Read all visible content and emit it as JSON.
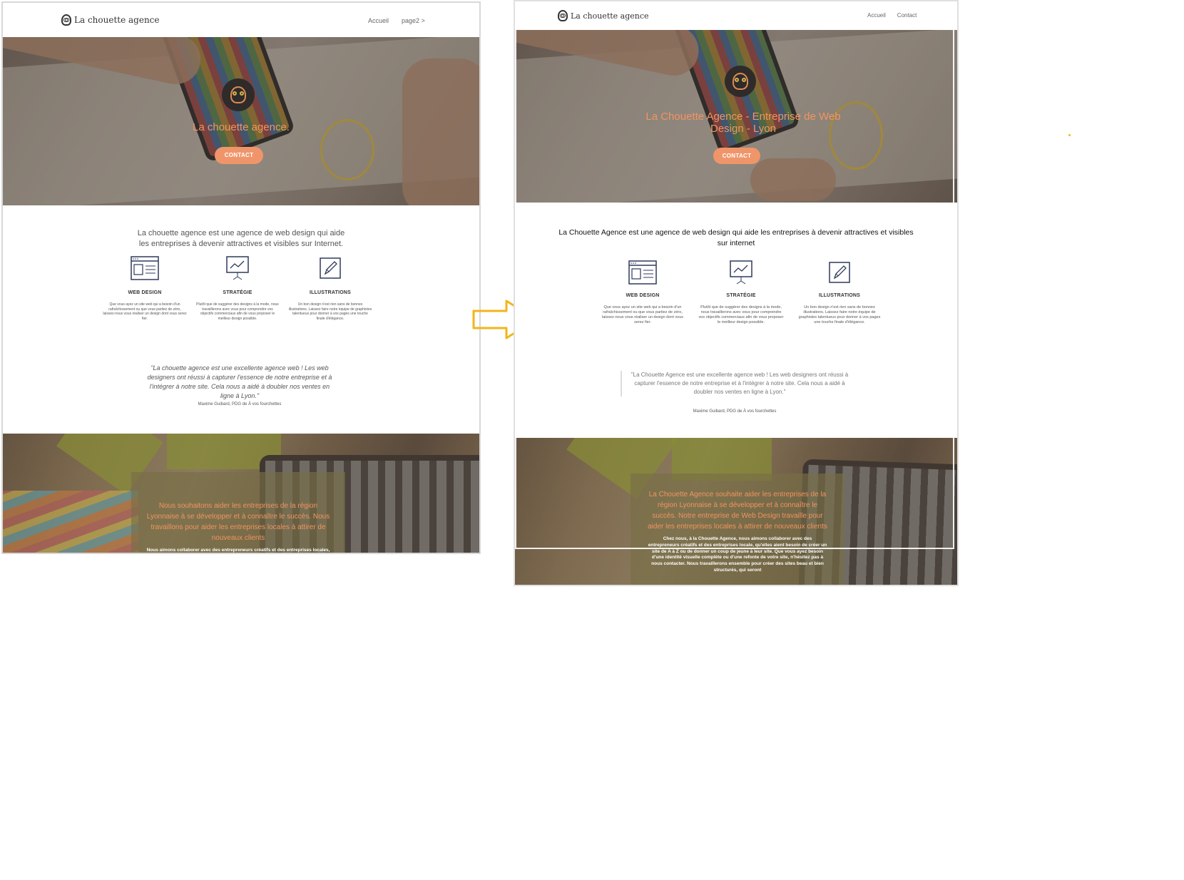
{
  "left": {
    "nav": {
      "logo_text": "La chouette agence",
      "links": [
        "Accueil",
        "page2 >"
      ]
    },
    "hero": {
      "title": "La chouette agence.",
      "cta": "CONTACT"
    },
    "intro": "La chouette agence est une agence de web design qui aide les entreprises à devenir attractives et visibles sur Internet.",
    "services": [
      {
        "title": "WEB DESIGN",
        "text": "Que vous ayez un site web qui a besoin d'un rafraîchissement ou que vous partiez de zéro, laissez-nous vous réaliser un design dont vous serez fier."
      },
      {
        "title": "STRATÉGIE",
        "text": "Plutôt que de suggérer des designs à la mode, nous travaillerons avec vous pour comprendre vos objectifs commerciaux afin de vous proposer le meilleur design possible."
      },
      {
        "title": "ILLUSTRATIONS",
        "text": "Un bon design n'est rien sans de bonnes illustrations. Laissez faire notre équipe de graphistes talentueux pour donner à vos pages une touche finale d'élégance."
      }
    ],
    "quote": "\"La chouette agence est une excellente agence web ! Les web designers ont réussi à capturer l'essence de notre entreprise et à l'intégrer à notre site. Cela nous a aidé à doubler nos ventes en ligne à Lyon.\"",
    "quote_author": "Maxime Guibard, PDG de À vos fourchettes",
    "bottom": {
      "title": "Nous souhaitons aider les entreprises de la région Lyonnaise à se développer et à connaître le succès. Nous travaillons pour aider les entreprises locales à attirer de nouveaux clients",
      "text": "Nous aimons collaborer avec des entrepreneurs créatifs et des entreprises locales, qu'elles aient"
    }
  },
  "right": {
    "nav": {
      "logo_text": "La chouette agence",
      "links": [
        "Accueil",
        "Contact"
      ]
    },
    "hero": {
      "title": "La Chouette Agence - Entreprise de Web Design - Lyon",
      "cta": "CONTACT"
    },
    "intro": "La Chouette Agence est une agence de web design qui aide les entreprises à devenir attractives et visibles sur internet",
    "services": [
      {
        "title": "WEB DESIGN",
        "text": "Que vous ayez un site web qui a besoin d'un rafraîchissement ou que vous partiez de zéro, laissez-nous vous réaliser un design dont vous serez fier."
      },
      {
        "title": "STRATÉGIE",
        "text": "Plutôt que de suggérer des designs à la mode, nous travaillerons avec vous pour comprendre vos objectifs commerciaux afin de vous proposer le meilleur design possible."
      },
      {
        "title": "ILLUSTRATIONS",
        "text": "Un bon design n'est rien sans de bonnes illustrations. Laissez faire notre équipe de graphistes talentueux pour donner à vos pages une touche finale d'élégance."
      }
    ],
    "quote": "\"La Chouette Agence est une excellente agence web ! Les web designers ont réussi à capturer l'essence de notre entreprise et à l'intégrer à notre site. Cela nous a aidé à doubler nos ventes en ligne à Lyon.\"",
    "quote_author": "Maxime Guibard, PDG de À vos fourchettes",
    "bottom": {
      "title": "La Chouette Agence souhaite aider les entreprises de la région Lyonnaise à se développer et à connaître le succès. Notre entreprise de Web Design travaille pour aider les entreprises locales à attirer de nouveaux clients",
      "text": "Chez nous, à la Chouette Agence, nous aimons collaborer avec des entrepreneurs créatifs et des entreprises locale, qu'elles aient besoin de créer un site de A à Z ou de donner un coup de jeune à leur site. Que vous ayez besoin d'une identité visuelle complète ou d'une refonte de votre site, n'hésitez pas à nous contacter. Nous travaillerons ensemble pour créer des sites beau et bien structurés, qui seront"
    }
  },
  "colors": {
    "accent": "#f29460",
    "button": "#f0956a",
    "arrow": "#f2b51c",
    "icon": "#2f3a5c"
  },
  "icons": [
    "owl-logo-icon",
    "browser-window-icon",
    "presentation-chart-icon",
    "pencil-square-icon",
    "right-arrow-icon"
  ]
}
